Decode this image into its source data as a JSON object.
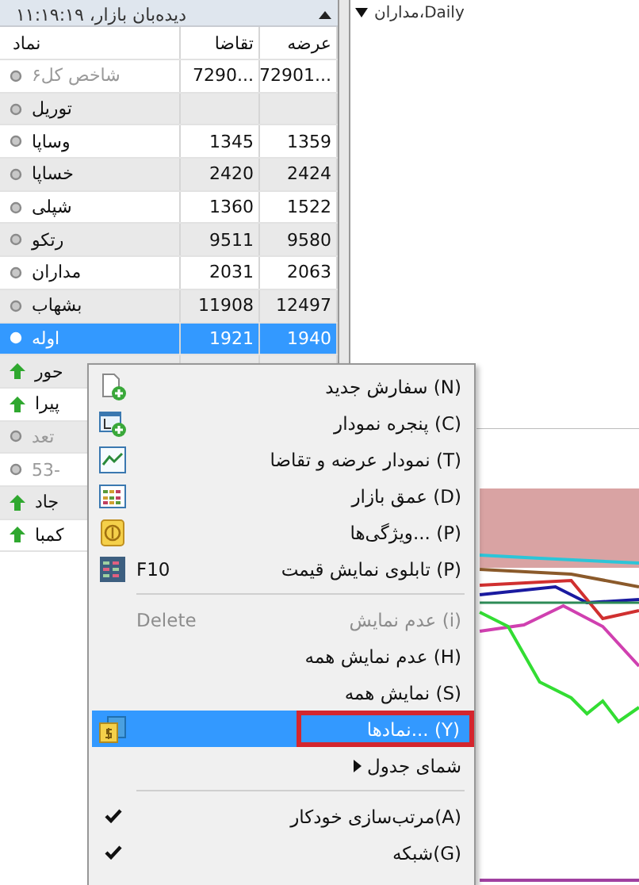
{
  "watch_panel": {
    "title": "دیده‌بان بازار، ۱۱:۱۹:۱۹",
    "columns": [
      "عرضه",
      "تقاضا",
      "نماد"
    ],
    "rows": [
      {
        "rising": false,
        "symbol": "شاخص کل۶",
        "bid": "7290...",
        "ask": "72901...",
        "dimmed": true,
        "selected": false
      },
      {
        "rising": false,
        "symbol": "توریل",
        "dimmed": false,
        "selected": false
      },
      {
        "rising": false,
        "symbol": "وساپا",
        "bid": "1345",
        "ask": "1359",
        "dimmed": false,
        "selected": false
      },
      {
        "rising": false,
        "symbol": "خساپا",
        "bid": "2420",
        "ask": "2424",
        "dimmed": false,
        "selected": false
      },
      {
        "rising": false,
        "symbol": "شپلی",
        "bid": "1360",
        "ask": "1522",
        "dimmed": false,
        "selected": false
      },
      {
        "rising": false,
        "symbol": "رتکو",
        "bid": "9511",
        "ask": "9580",
        "dimmed": false,
        "selected": false
      },
      {
        "rising": false,
        "symbol": "مداران",
        "bid": "2031",
        "ask": "2063",
        "dimmed": false,
        "selected": false
      },
      {
        "rising": false,
        "symbol": "بشهاب",
        "bid": "11908",
        "ask": "12497",
        "dimmed": false,
        "selected": false
      },
      {
        "rising": false,
        "symbol": "اوله",
        "bid": "1921",
        "ask": "1940",
        "dimmed": false,
        "selected": true
      },
      {
        "rising": true,
        "symbol": "حور",
        "dimmed": false,
        "selected": false
      },
      {
        "rising": true,
        "symbol": "پیرا",
        "dimmed": false,
        "selected": false
      },
      {
        "rising": false,
        "symbol": "تعد",
        "dimmed": true,
        "selected": false
      },
      {
        "rising": false,
        "symbol": "53-",
        "dimmed": true,
        "selected": false
      },
      {
        "rising": true,
        "symbol": "جاد",
        "dimmed": false,
        "selected": false
      },
      {
        "rising": true,
        "symbol": "کمبا",
        "dimmed": false,
        "selected": false
      }
    ]
  },
  "chart": {
    "title": "مداران،Daily"
  },
  "context_menu": {
    "items": [
      {
        "kind": "command",
        "label": "سفارش جدید (N)",
        "disabled": false,
        "selected": false,
        "checked": false
      },
      {
        "kind": "command",
        "label": "پنجره نمودار (C)",
        "disabled": false,
        "selected": false,
        "checked": false
      },
      {
        "kind": "command",
        "label": "نمودار عرضه و تقاضا (T)",
        "disabled": false,
        "selected": false,
        "checked": false
      },
      {
        "kind": "command",
        "label": "عمق بازار (D)",
        "disabled": false,
        "selected": false,
        "checked": false
      },
      {
        "kind": "command",
        "label": "ویژگی‌ها... (P)",
        "disabled": false,
        "selected": false,
        "checked": false
      },
      {
        "kind": "command",
        "label": "تابلوی نمایش قیمت (P)",
        "shortcut": "F10",
        "disabled": false,
        "selected": false,
        "checked": false
      },
      {
        "kind": "separator"
      },
      {
        "kind": "command",
        "label": "عدم نمایش (i)",
        "shortcut": "Delete",
        "disabled": true,
        "selected": false,
        "checked": false
      },
      {
        "kind": "command",
        "label": "عدم نمایش همه (H)",
        "disabled": false,
        "selected": false,
        "checked": false
      },
      {
        "kind": "command",
        "label": "نمایش همه (S)",
        "disabled": false,
        "selected": false,
        "checked": false
      },
      {
        "kind": "command",
        "label": "نمادها... (Y)",
        "disabled": false,
        "selected": true,
        "checked": false
      },
      {
        "kind": "submenu",
        "label": "شمای جدول",
        "disabled": false,
        "selected": false,
        "checked": false
      },
      {
        "kind": "separator"
      },
      {
        "kind": "command",
        "label": "مرتب‌سازی خودکار(A)",
        "disabled": false,
        "selected": false,
        "checked": true
      },
      {
        "kind": "command",
        "label": "شبکه(G)",
        "disabled": false,
        "selected": false,
        "checked": true
      }
    ]
  }
}
